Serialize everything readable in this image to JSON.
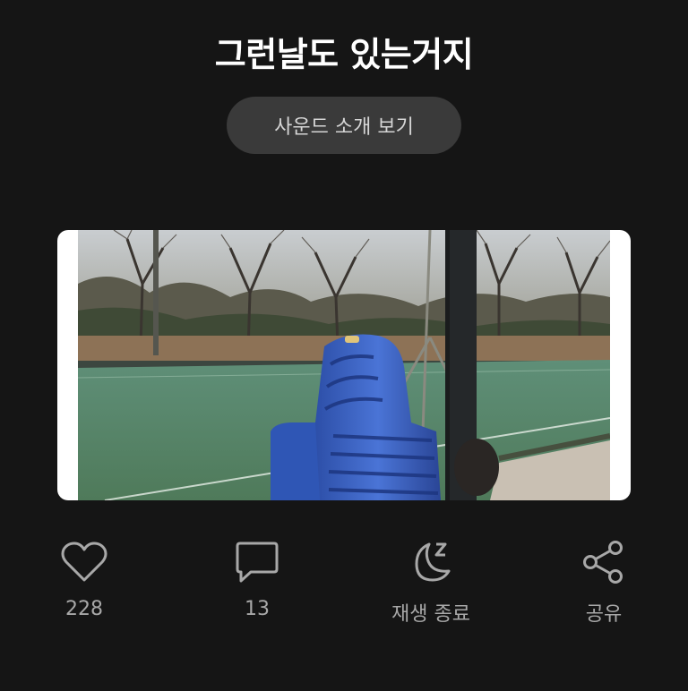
{
  "header": {
    "title": "그런날도 있는거지",
    "sound_button_label": "사운드 소개 보기"
  },
  "photo": {
    "description_icon": "photo-of-blue-stacked-chairs-by-park-field"
  },
  "actions": {
    "like": {
      "icon": "heart-icon",
      "count": "228"
    },
    "comment": {
      "icon": "speech-bubble-icon",
      "count": "13"
    },
    "sleep_timer": {
      "icon": "moon-sleep-icon",
      "label": "재생 종료"
    },
    "share": {
      "icon": "share-icon",
      "label": "공유"
    }
  },
  "colors": {
    "background": "#151515",
    "button_bg": "#3a3a3a",
    "icon_color": "#a8a8a8"
  }
}
